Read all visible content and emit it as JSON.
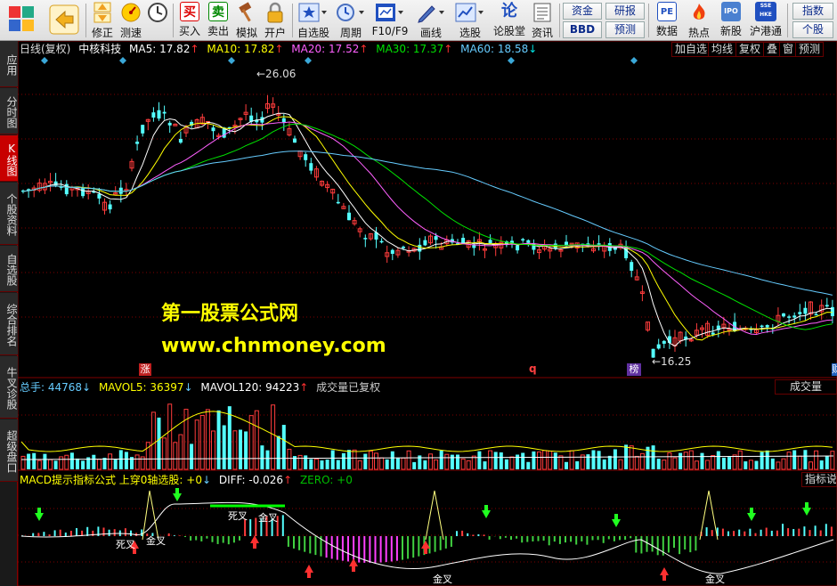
{
  "toolbar": {
    "left_buttons": [
      {
        "label": "",
        "icon": "grid-icon"
      },
      {
        "label": "",
        "icon": "back-icon"
      },
      {
        "label": "修正",
        "icon": "updown-icon"
      },
      {
        "label": "测速",
        "icon": "speed-icon"
      },
      {
        "label": "",
        "icon": "clock-icon"
      },
      {
        "label": "买入",
        "icon": "buy-icon",
        "glyph": "买"
      },
      {
        "label": "卖出",
        "icon": "sell-icon",
        "glyph": "卖"
      },
      {
        "label": "模拟",
        "icon": "hammer-icon"
      },
      {
        "label": "开户",
        "icon": "lock-icon"
      },
      {
        "label": "自选股",
        "icon": "star-icon"
      },
      {
        "label": "周期",
        "icon": "period-icon"
      },
      {
        "label": "F10/F9",
        "icon": "f10-icon"
      },
      {
        "label": "画线",
        "icon": "pen-icon"
      },
      {
        "label": "选股",
        "icon": "select-icon"
      },
      {
        "label": "论股堂",
        "icon": "forum-icon",
        "glyph": "论"
      },
      {
        "label": "资讯",
        "icon": "news-icon"
      },
      {
        "label": "数据",
        "icon": "pe-icon",
        "glyph": "PE"
      },
      {
        "label": "热点",
        "icon": "hot-icon"
      },
      {
        "label": "新股",
        "icon": "ipo-icon"
      },
      {
        "label": "沪港通",
        "icon": "sse-hk-icon"
      }
    ],
    "small_buttons": [
      "资金",
      "BBD",
      "研报",
      "预测",
      "指数",
      "个股"
    ],
    "extra_labels": {
      "clock_label": "",
      "ipo_glyph": "IPO",
      "sse_glyph": "SSE HKE"
    }
  },
  "sidebar": {
    "tabs": [
      {
        "label": "应用",
        "active": false
      },
      {
        "label": "分时图",
        "active": false
      },
      {
        "label": "K线图",
        "active": true
      },
      {
        "label": "个股资料",
        "active": false
      },
      {
        "label": "自选股",
        "active": false
      },
      {
        "label": "综合排名",
        "active": false
      },
      {
        "label": "牛叉诊股",
        "active": false
      },
      {
        "label": "超级盘口",
        "active": false
      }
    ]
  },
  "main_panel": {
    "period": "日线(复权)",
    "stock_name": "中核科技",
    "ma": [
      {
        "label": "MA5: 17.82",
        "arrow": "↑",
        "color": "#ffffff",
        "arrow_color": "#ff3030"
      },
      {
        "label": "MA10: 17.82",
        "arrow": "↑",
        "color": "#ffff00",
        "arrow_color": "#ff3030"
      },
      {
        "label": "MA20: 17.52",
        "arrow": "↑",
        "color": "#ff60ff",
        "arrow_color": "#ff3030"
      },
      {
        "label": "MA30: 17.37",
        "arrow": "↑",
        "color": "#00e000",
        "arrow_color": "#ff3030"
      },
      {
        "label": "MA60: 18.58",
        "arrow": "↓",
        "color": "#66ccff",
        "arrow_color": "#00e0e0"
      }
    ],
    "right_buttons": [
      "加自选",
      "均线",
      "复权",
      "叠",
      "窗",
      "预测"
    ],
    "high_label": "←26.06",
    "low_label": "←16.25",
    "markers": [
      "涨",
      "q",
      "榜",
      "财"
    ],
    "watermark_title": "第一股票公式网",
    "watermark_url": "www.chnmoney.com"
  },
  "volume_panel": {
    "zongshou": "总手: 44768",
    "zongshou_arrow": "↓",
    "mavol5": "MAVOL5: 36397",
    "mavol5_arrow": "↓",
    "mavol120": "MAVOL120: 94223",
    "mavol120_arrow": "↑",
    "note": "成交量已复权",
    "button": "成交量"
  },
  "macd_panel": {
    "title": "MACD提示指标公式 上穿0轴选股: +0",
    "title_arrow": "↓",
    "diff": "DIFF: -0.026",
    "diff_arrow": "↑",
    "zero": "ZERO: +0",
    "button": "指标说",
    "labels": {
      "dead": "死叉",
      "gold": "金叉"
    }
  },
  "colors": {
    "up": "#ff3c3c",
    "down": "#54ffff",
    "grid": "#800000",
    "ma5": "#ffffff",
    "ma10": "#ffff00",
    "ma20": "#ff60ff",
    "ma30": "#00e000",
    "ma60": "#66ccff",
    "watermark": "#ffff00"
  }
}
